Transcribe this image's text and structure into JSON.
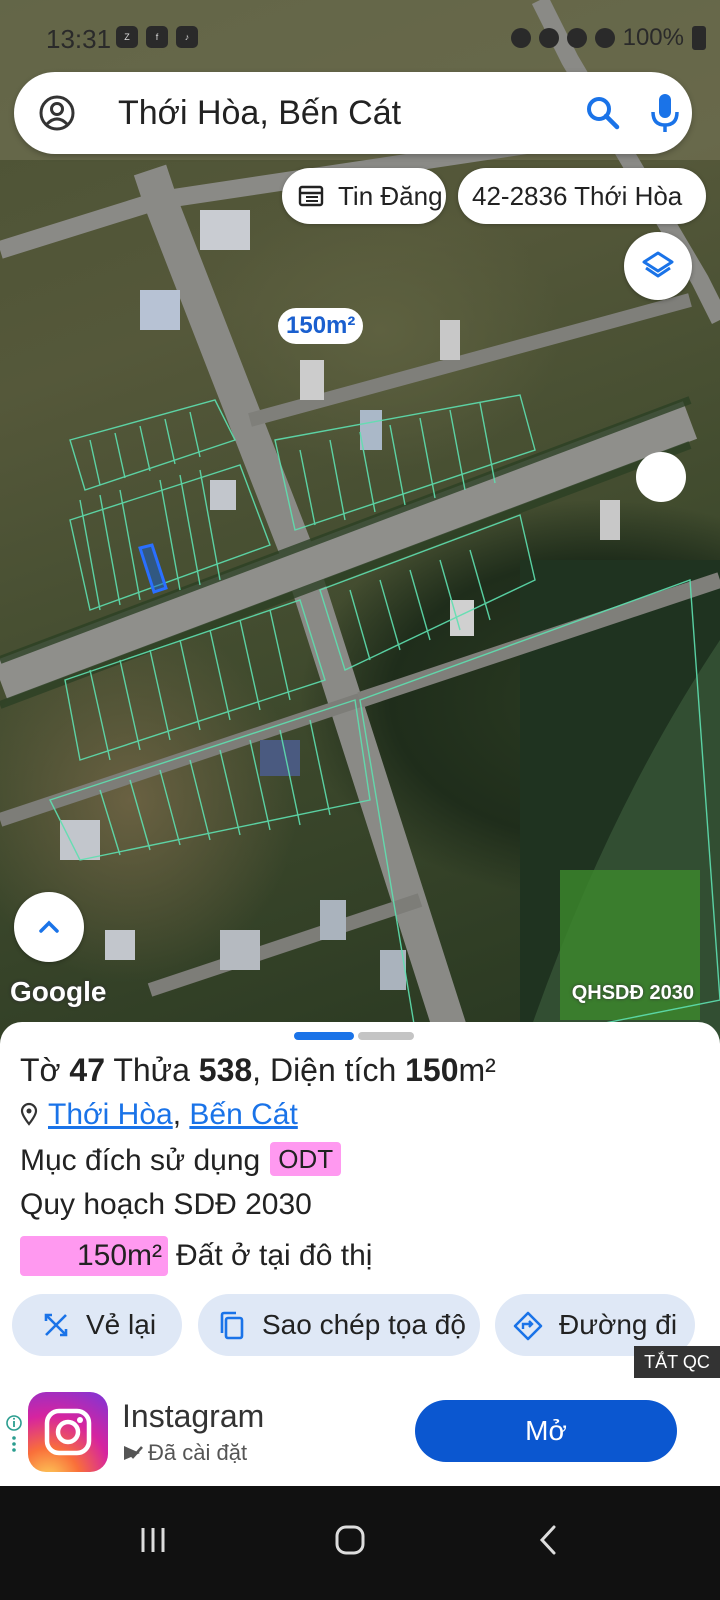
{
  "status_bar": {
    "time": "13:31",
    "battery": "100%"
  },
  "search": {
    "query": "Thới Hòa, Bến Cát"
  },
  "chips": {
    "listing": "Tin Đăng",
    "parcel": "42-2836 Thới Hòa"
  },
  "map": {
    "area_label": "150m²",
    "attribution": "Google",
    "layer_name": "QHSDĐ 2030"
  },
  "sheet": {
    "title": {
      "prefix_sheet": "Tờ ",
      "sheet_number": "47",
      "prefix_lot": " Thửa ",
      "lot_number": "538",
      "prefix_area": ", Diện tích ",
      "area_value": "150",
      "area_unit": "m²"
    },
    "location": {
      "ward": "Thới Hòa",
      "separator": ", ",
      "district": "Bến Cát"
    },
    "usage": {
      "label": "Mục đích sử dụng",
      "code": "ODT"
    },
    "plan": "Quy hoạch SDĐ 2030",
    "zone": {
      "area": "150m²",
      "description": "Đất ở tại đô thị"
    },
    "actions": {
      "redraw": "Vẻ lại",
      "copy": "Sao chép tọa độ",
      "directions": "Đường đi"
    }
  },
  "ad": {
    "close_label": "TẮT QC",
    "app_name": "Instagram",
    "installed": "Đã cài đặt",
    "open": "Mở"
  },
  "colors": {
    "accent": "#1a73e8",
    "zone_pink": "#ff99f0",
    "open_button": "#0b57d0",
    "parcel_line": "#5ee0b0"
  }
}
